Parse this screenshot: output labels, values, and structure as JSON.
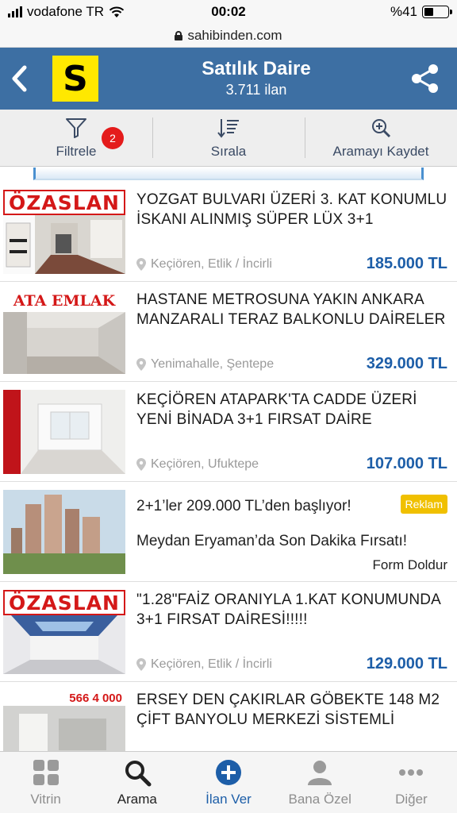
{
  "status": {
    "carrier": "vodafone TR",
    "time": "00:02",
    "battery": "%41",
    "battery_level": 0.41
  },
  "browser": {
    "url": "sahibinden.com"
  },
  "header": {
    "logo_letter": "S",
    "title": "Satılık Daire",
    "subtitle": "3.711 ilan"
  },
  "toolbar": {
    "filter_label": "Filtrele",
    "filter_badge": "2",
    "sort_label": "Sırala",
    "save_search_label": "Aramayı Kaydet"
  },
  "listings": [
    {
      "thumb_text": "ÖZASLAN",
      "title": "YOZGAT BULVARI ÜZERİ 3. KAT KONUMLU İSKANI ALINMIŞ SÜPER LÜX 3+1",
      "location": "Keçiören,  Etlik / İncirli",
      "price": "185.000 TL"
    },
    {
      "thumb_text": "ATA EMLAK",
      "title": "HASTANE METROSUNA YAKIN ANKARA MANZARALI TERAZ BALKONLU DAİRELER",
      "location": "Yenimahalle,  Şentepe",
      "price": "329.000 TL"
    },
    {
      "thumb_text": "",
      "title": "KEÇİÖREN ATAPARK'TA CADDE ÜZERİ YENİ BİNADA 3+1 FIRSAT DAİRE",
      "location": "Keçiören,  Ufuktepe",
      "price": "107.000 TL"
    }
  ],
  "ad": {
    "title": "2+1’ler 209.000 TL’den başlıyor!",
    "badge": "Reklam",
    "subtitle": "Meydan Eryaman’da Son Dakika Fırsatı!",
    "action": "Form Doldur"
  },
  "listings2": [
    {
      "thumb_text": "ÖZASLAN",
      "title": "\"1.28\"FAİZ ORANIYLA 1.KAT KONUMUNDA 3+1 FIRSAT DAİRESİ!!!!!",
      "location": "Keçiören,  Etlik / İncirli",
      "price": "129.000 TL"
    },
    {
      "thumb_text": "566 4 000",
      "title": "ERSEY DEN ÇAKIRLAR GÖBEKTE 148 M2 ÇİFT BANYOLU MERKEZİ SİSTEMLİ"
    }
  ],
  "bottom_nav": {
    "vitrin": "Vitrin",
    "arama": "Arama",
    "ilan_ver": "İlan Ver",
    "bana_ozel": "Bana Özel",
    "diger": "Diğer"
  },
  "colors": {
    "header": "#3d6fa3",
    "logo": "#ffe800",
    "price": "#1d5ea8",
    "badge": "#e41b1b",
    "ad_badge": "#f0c000"
  }
}
